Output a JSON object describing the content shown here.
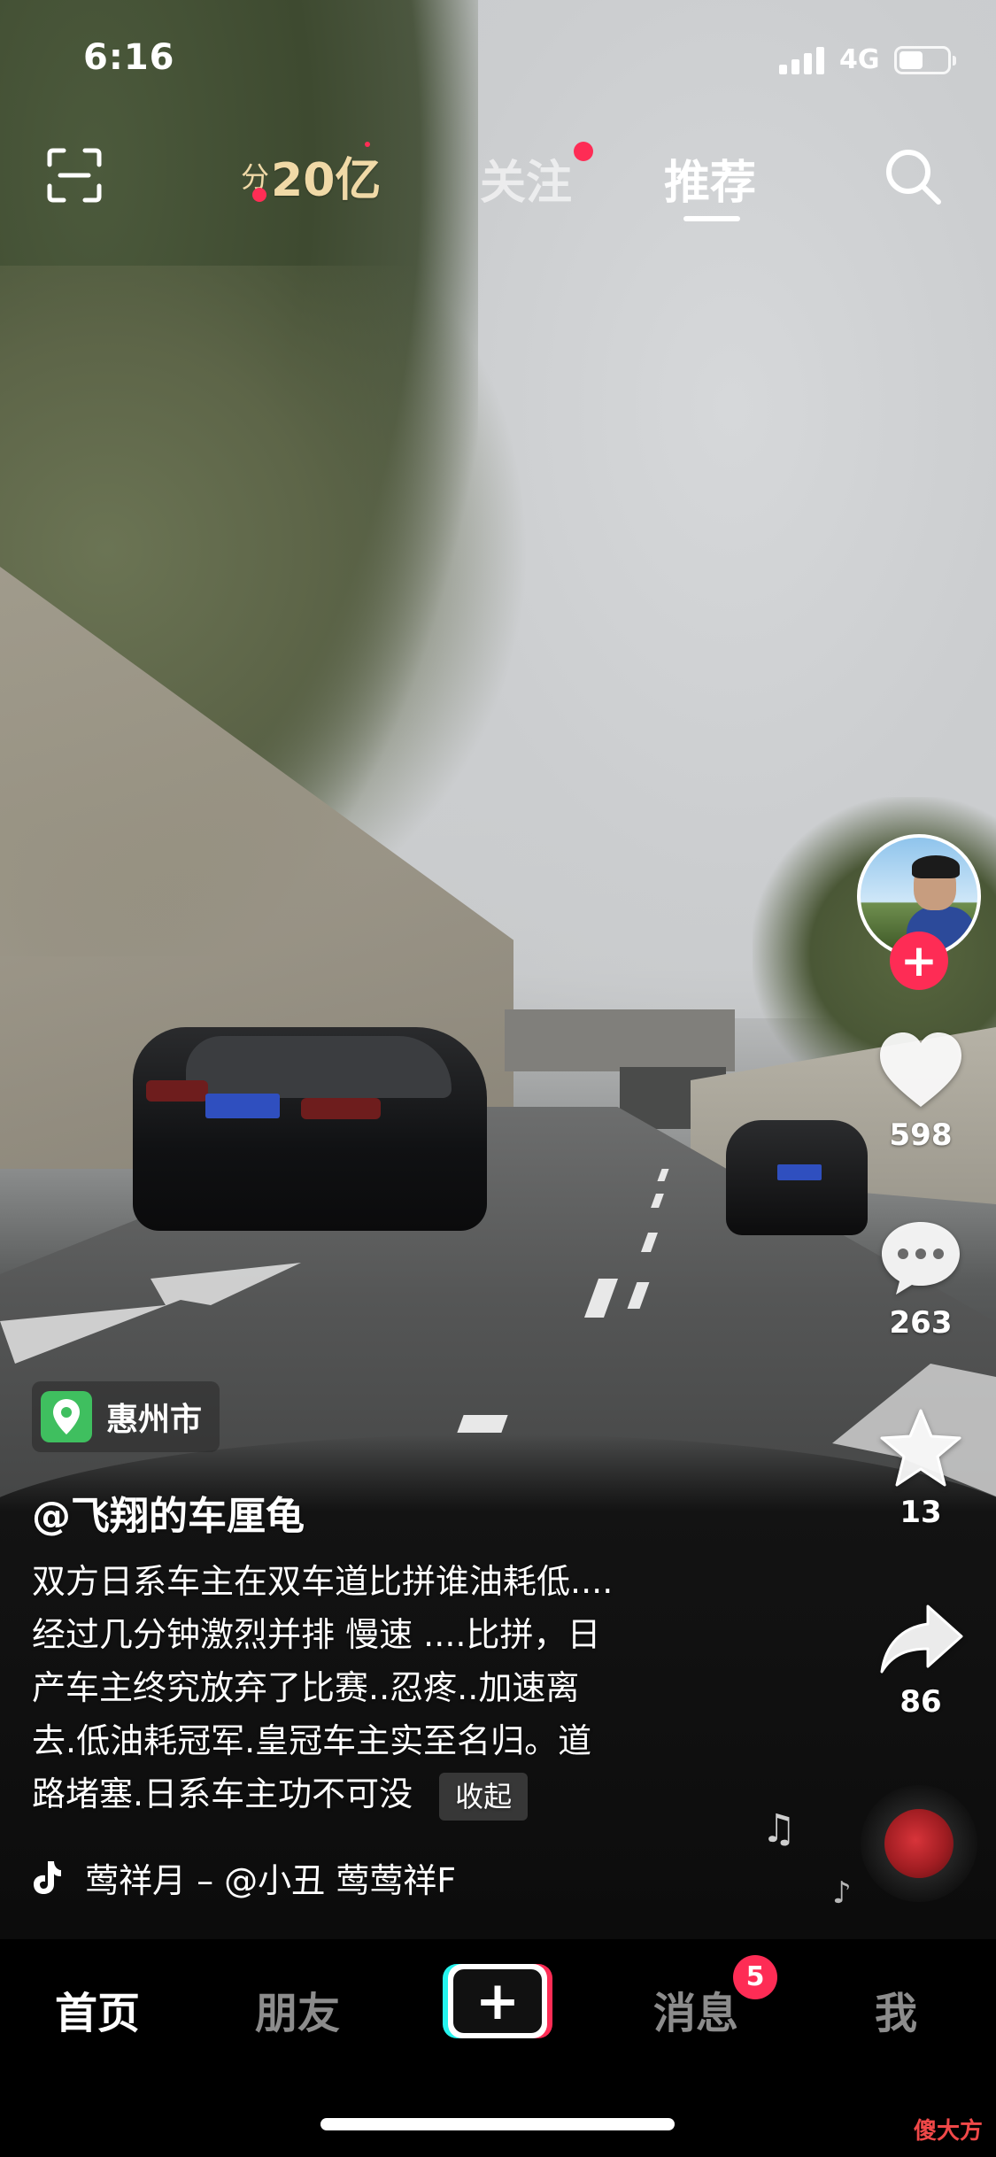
{
  "status_bar": {
    "time": "6:16",
    "network": "4G",
    "battery_level": 0.5
  },
  "top_nav": {
    "coin_prefix": "分",
    "coin_text": "20亿",
    "tabs": [
      {
        "label": "关注",
        "active": false,
        "has_dot": true
      },
      {
        "label": "推荐",
        "active": true
      }
    ],
    "icons": [
      "scan-icon",
      "search-icon"
    ]
  },
  "right_rail": {
    "likes": "598",
    "comments": "263",
    "favorites": "13",
    "shares": "86",
    "follow_label": "+"
  },
  "caption": {
    "location": "惠州市",
    "author": "@飞翔的车厘龟",
    "lines": [
      "双方日系车主在双车道比拼谁油耗低....",
      "经过几分钟激烈并排 慢速 ....比拼，日",
      "产车主终究放弃了比赛..忍疼..加速离",
      "去.低油耗冠军.皇冠车主实至名归。道",
      "路堵塞.日系车主功不可没"
    ],
    "collapse_label": "收起",
    "music": "莺祥月 – @小丑    莺莺祥F"
  },
  "tabbar": {
    "home": "首页",
    "friends": "朋友",
    "create": "+",
    "messages": "消息",
    "messages_badge": "5",
    "me": "我"
  },
  "watermark": "傻大方",
  "colors": {
    "accent": "#fe2c55",
    "cyan": "#25f4ee",
    "coin": "#f0d9a7",
    "location": "#3fbf5f"
  }
}
